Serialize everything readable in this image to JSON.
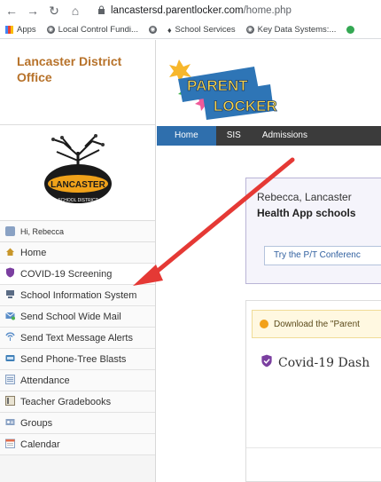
{
  "browser": {
    "url_host": "lancastersd.parentlocker.com",
    "url_path": "/home.php",
    "bookmarks": [
      "Apps",
      "Local Control Fundi...",
      "School Services",
      "Key Data Systems:..."
    ]
  },
  "sidebar": {
    "org_name": "Lancaster District Office",
    "logo_text": "LANCASTER",
    "logo_subtext": "SCHOOL DISTRICT",
    "greeting": "Hi, Rebecca",
    "items": [
      {
        "label": "Home",
        "icon": "home-icon"
      },
      {
        "label": "COVID-19 Screening",
        "icon": "shield-icon"
      },
      {
        "label": "School Information System",
        "icon": "computer-icon"
      },
      {
        "label": "Send School Wide Mail",
        "icon": "mail-icon"
      },
      {
        "label": "Send Text Message Alerts",
        "icon": "broadcast-icon"
      },
      {
        "label": "Send Phone-Tree Blasts",
        "icon": "phone-icon"
      },
      {
        "label": "Attendance",
        "icon": "list-icon"
      },
      {
        "label": "Teacher Gradebooks",
        "icon": "gradebook-icon"
      },
      {
        "label": "Groups",
        "icon": "groups-icon"
      },
      {
        "label": "Calendar",
        "icon": "calendar-icon"
      }
    ]
  },
  "brand": {
    "line1": "PARENT",
    "line2": "LOCKER"
  },
  "navbar": {
    "tabs": [
      "Home",
      "SIS",
      "Admissions"
    ]
  },
  "banner": {
    "line1": "Rebecca, Lancaster",
    "line2": "Health App schools",
    "button": "Try the P/T Conferenc"
  },
  "notice": {
    "text": "Download the \"Parent"
  },
  "dashboard": {
    "title": "Covid-19 Dash"
  },
  "colors": {
    "accent": "#2f6fad",
    "org": "#b7722a",
    "arrow": "#e53935",
    "shield": "#7b3fa0"
  }
}
